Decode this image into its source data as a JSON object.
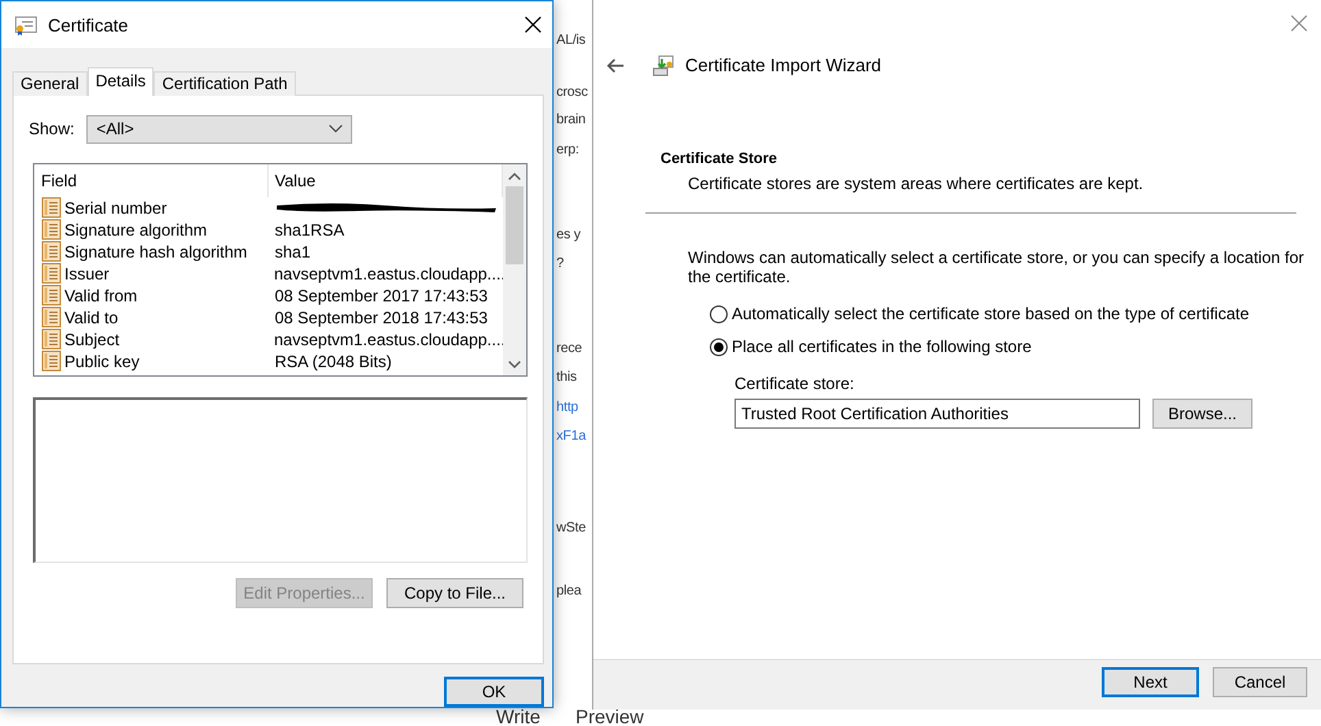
{
  "background": {
    "fragments": [
      {
        "text": "AL/is",
        "kind": "plain"
      },
      {
        "text": "crosc",
        "kind": "plain"
      },
      {
        "text": "brain",
        "kind": "plain"
      },
      {
        "text": "erp:",
        "kind": "plain"
      },
      {
        "text": "es y",
        "kind": "plain"
      },
      {
        "text": "?",
        "kind": "plain"
      },
      {
        "text": "rece",
        "kind": "plain"
      },
      {
        "text": "this",
        "kind": "plain"
      },
      {
        "text": "http",
        "kind": "link"
      },
      {
        "text": "xF1a",
        "kind": "link"
      },
      {
        "text": "wSte",
        "kind": "plain"
      },
      {
        "text": "plea",
        "kind": "plain"
      }
    ],
    "bottom_tabs": [
      "Write",
      "Preview"
    ]
  },
  "certificate_dialog": {
    "title": "Certificate",
    "tabs": [
      {
        "label": "General",
        "selected": false
      },
      {
        "label": "Details",
        "selected": true
      },
      {
        "label": "Certification Path",
        "selected": false
      }
    ],
    "show_label": "Show:",
    "show_value": "<All>",
    "columns": [
      "Field",
      "Value"
    ],
    "rows": [
      {
        "field": "Serial number",
        "value": "",
        "redacted": true
      },
      {
        "field": "Signature algorithm",
        "value": "sha1RSA",
        "redacted": false
      },
      {
        "field": "Signature hash algorithm",
        "value": "sha1",
        "redacted": false
      },
      {
        "field": "Issuer",
        "value": "navseptvm1.eastus.cloudapp....",
        "redacted": false
      },
      {
        "field": "Valid from",
        "value": "08 September 2017 17:43:53",
        "redacted": false
      },
      {
        "field": "Valid to",
        "value": "08 September 2018 17:43:53",
        "redacted": false
      },
      {
        "field": "Subject",
        "value": "navseptvm1.eastus.cloudapp....",
        "redacted": false
      },
      {
        "field": "Public key",
        "value": "RSA (2048 Bits)",
        "redacted": false
      }
    ],
    "buttons": [
      {
        "label": "Edit Properties...",
        "disabled": true
      },
      {
        "label": "Copy to File...",
        "disabled": false
      }
    ],
    "ok": "OK"
  },
  "wizard": {
    "title": "Certificate Import Wizard",
    "heading": "Certificate Store",
    "subheading": "Certificate stores are system areas where certificates are kept.",
    "intro": "Windows can automatically select a certificate store, or you can specify a location for the certificate.",
    "options": [
      {
        "label": "Automatically select the certificate store based on the type of certificate",
        "selected": false
      },
      {
        "label": "Place all certificates in the following store",
        "selected": true
      }
    ],
    "store_label": "Certificate store:",
    "store_value": "Trusted Root Certification Authorities",
    "browse": "Browse...",
    "next": "Next",
    "cancel": "Cancel"
  }
}
